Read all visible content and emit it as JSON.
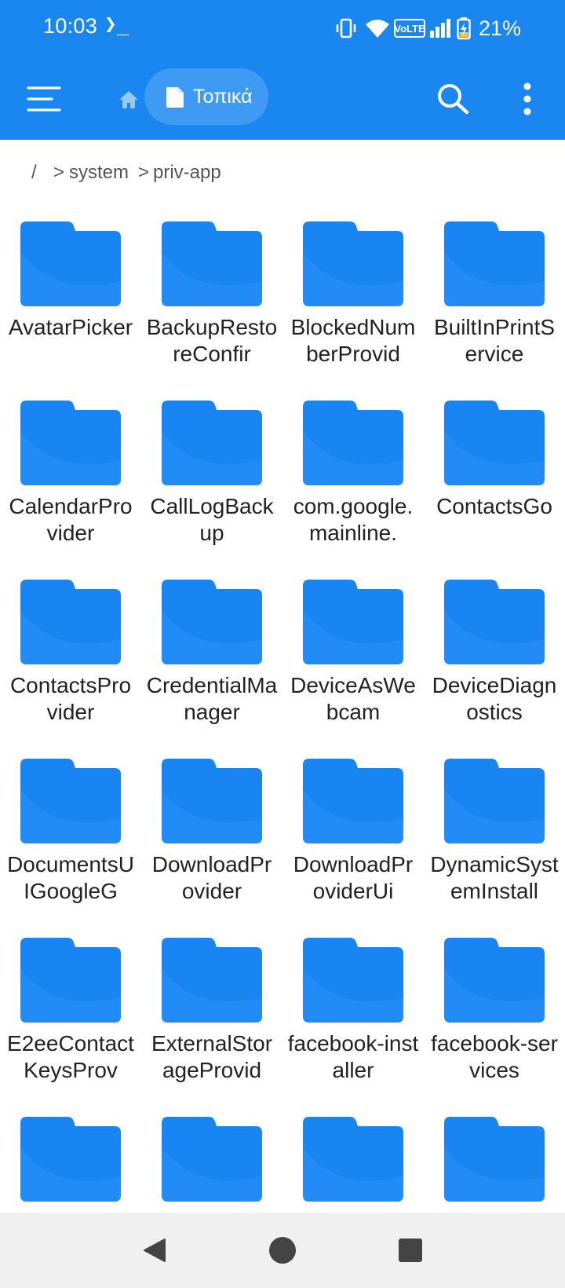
{
  "status_bar": {
    "time": "10:03",
    "terminal_glyph": "❯_",
    "volte": "VoLTE",
    "battery_percent": "21%",
    "icons": [
      "vibrate-icon",
      "wifi-icon",
      "volte-icon",
      "signal-icon",
      "battery-charging-icon"
    ]
  },
  "app_bar": {
    "location_chip": "Τοπικά",
    "icons": [
      "menu-icon",
      "home-icon",
      "document-icon",
      "search-icon",
      "more-vert-icon"
    ]
  },
  "breadcrumb": {
    "root": "/",
    "separator": ">",
    "items": [
      "system",
      "priv-app"
    ]
  },
  "folders": [
    {
      "name": "AvatarPicker"
    },
    {
      "name": "BackupRestoreConfir"
    },
    {
      "name": "BlockedNumberProvid"
    },
    {
      "name": "BuiltInPrintService"
    },
    {
      "name": "CalendarProvider"
    },
    {
      "name": "CallLogBackup"
    },
    {
      "name": "com.google.mainline."
    },
    {
      "name": "ContactsGo"
    },
    {
      "name": "ContactsProvider"
    },
    {
      "name": "CredentialManager"
    },
    {
      "name": "DeviceAsWebcam"
    },
    {
      "name": "DeviceDiagnostics"
    },
    {
      "name": "DocumentsUIGoogleG"
    },
    {
      "name": "DownloadProvider"
    },
    {
      "name": "DownloadProviderUi"
    },
    {
      "name": "DynamicSystemInstall"
    },
    {
      "name": "E2eeContactKeysProv"
    },
    {
      "name": "ExternalStorageProvid"
    },
    {
      "name": "facebook-installer"
    },
    {
      "name": "facebook-services"
    },
    {
      "name": ""
    },
    {
      "name": ""
    },
    {
      "name": ""
    },
    {
      "name": ""
    }
  ],
  "nav_bar": {
    "icons": [
      "back-icon",
      "home-circle-icon",
      "recents-icon"
    ]
  },
  "colors": {
    "primary": "#1a87f0",
    "folder": "#1985f3",
    "folder_tab": "#1476e0",
    "nav_background": "#f0f0f0"
  }
}
